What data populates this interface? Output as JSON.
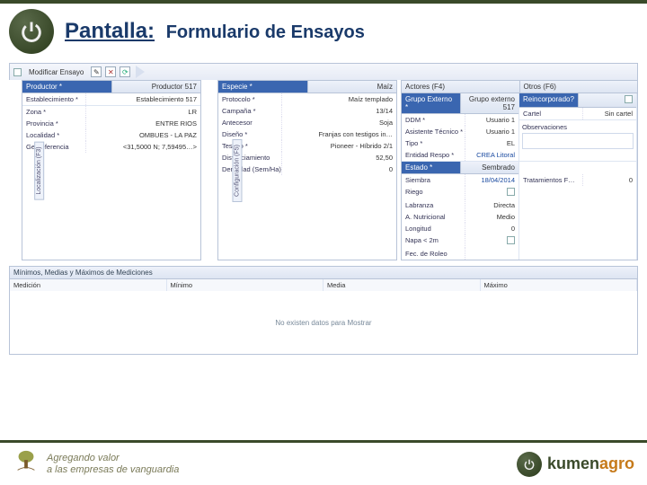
{
  "header": {
    "title_main": "Pantalla:",
    "title_sub": "Formulario de Ensayos"
  },
  "tabbar": {
    "title": "Modificar Ensayo"
  },
  "panel_loc": {
    "sidetab": "Localización (F3)",
    "head": {
      "active": "Productor *",
      "val": "Productor 517"
    },
    "rows": [
      {
        "lbl": "Establecimiento *",
        "val": "Establecimiento 517"
      },
      {
        "lbl": "Zona *",
        "val": "LR"
      },
      {
        "lbl": "Provincia *",
        "val": "ENTRE RIOS"
      },
      {
        "lbl": "Localidad *",
        "val": "OMBUES - LA PAZ"
      },
      {
        "lbl": "Georeferencia",
        "val": "<31,5000 N; 7,59495…>"
      }
    ]
  },
  "panel_cfg": {
    "sidetab": "Configuración (F5)",
    "head": {
      "lbl": "Especie *",
      "val": "Maíz"
    },
    "rows": [
      {
        "lbl": "Protocolo *",
        "val": "Maíz templado"
      },
      {
        "lbl": "Campaña *",
        "val": "13/14"
      },
      {
        "lbl": "Antecesor",
        "val": "Soja"
      },
      {
        "lbl": "Diseño *",
        "val": "Franjas con testigos in…"
      },
      {
        "lbl": "Testigo *",
        "val": "Pioneer - Híbrido 2/1"
      },
      {
        "lbl": "Distanciamiento",
        "val": "52,50"
      },
      {
        "lbl": "Densidad (Sem/Ha)",
        "val": "0"
      }
    ]
  },
  "panel_right": {
    "tabs": {
      "t1": "Actores (F4)",
      "t2": "Otros (F6)"
    },
    "head_left": {
      "lbl": "Grupo Externo *",
      "val": "Grupo externo 517"
    },
    "head_right": {
      "lbl": "Reincorporado?"
    },
    "col1": [
      {
        "lbl": "DDM *",
        "val": "Usuario 1"
      },
      {
        "lbl": "Asistente Técnico *",
        "val": "Usuario 1"
      },
      {
        "lbl": "Tipo *",
        "val": "EL"
      },
      {
        "lbl": "Entidad Respo *",
        "val": "CREA Litoral"
      }
    ],
    "col2": [
      {
        "lbl": "Cartel",
        "val": "Sin cartel"
      }
    ],
    "mid_head": {
      "lbl": "Estado *",
      "val": "Sembrado"
    },
    "mid": [
      {
        "lbl": "Siembra",
        "val": "18/04/2014"
      },
      {
        "lbl": "Riego",
        "val": "",
        "check": true
      },
      {
        "lbl": "Labranza",
        "val": "Directa"
      },
      {
        "lbl": "A. Nutricional",
        "val": "Medio"
      },
      {
        "lbl": "Longitud",
        "val": "0"
      },
      {
        "lbl": "Napa < 2m",
        "val": "",
        "check": true
      },
      {
        "lbl": "Fec. de Roleo",
        "val": ""
      }
    ],
    "mid2": [
      {
        "lbl": "Tratamientos F…",
        "val": "0"
      }
    ],
    "obs_label": "Observaciones"
  },
  "table": {
    "title": "Mínimos, Medias y Máximos de Mediciones",
    "cols": [
      "Medición",
      "Mínimo",
      "Media",
      "Máximo"
    ],
    "empty": "No existen datos para Mostrar"
  },
  "footer": {
    "tagline1": "Agregando valor",
    "tagline2": "a las empresas de vanguardia",
    "brand_a": "kumen",
    "brand_b": "agro"
  }
}
